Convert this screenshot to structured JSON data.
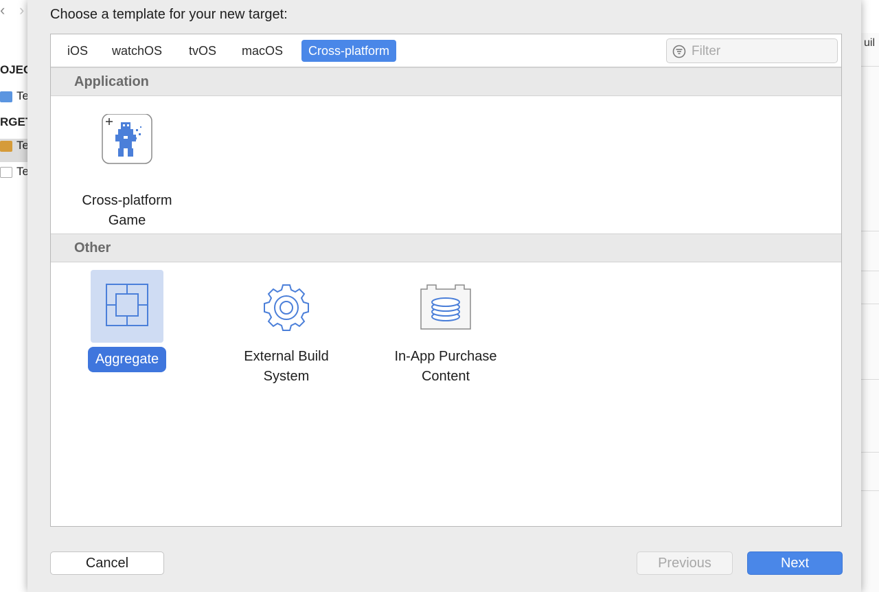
{
  "background": {
    "nav_back": "‹",
    "nav_forward": "›",
    "sidebar_rows": [
      "OJEC",
      "Te",
      "RGET",
      "Te",
      "Te"
    ],
    "right_panel_text": "uil"
  },
  "dialog": {
    "title": "Choose a template for your new target:",
    "tabs": [
      {
        "label": "iOS",
        "active": false
      },
      {
        "label": "watchOS",
        "active": false
      },
      {
        "label": "tvOS",
        "active": false
      },
      {
        "label": "macOS",
        "active": false
      },
      {
        "label": "Cross-platform",
        "active": true
      }
    ],
    "filter": {
      "placeholder": "Filter",
      "value": "",
      "icon": "filter-icon"
    },
    "sections": [
      {
        "header": "Application",
        "templates": [
          {
            "label": "Cross-platform\nGame",
            "icon": "game-character-icon",
            "selected": false
          }
        ]
      },
      {
        "header": "Other",
        "templates": [
          {
            "label": "Aggregate",
            "icon": "aggregate-icon",
            "selected": true
          },
          {
            "label": "External Build\nSystem",
            "icon": "gear-icon",
            "selected": false
          },
          {
            "label": "In-App Purchase\nContent",
            "icon": "database-box-icon",
            "selected": false
          }
        ]
      }
    ],
    "buttons": {
      "cancel": "Cancel",
      "previous": "Previous",
      "next": "Next"
    },
    "colors": {
      "accent": "#4a87e8",
      "selection_label": "#3f76dd",
      "selection_tile": "#cfdcf3",
      "icon_blue": "#4b7fd9"
    }
  }
}
